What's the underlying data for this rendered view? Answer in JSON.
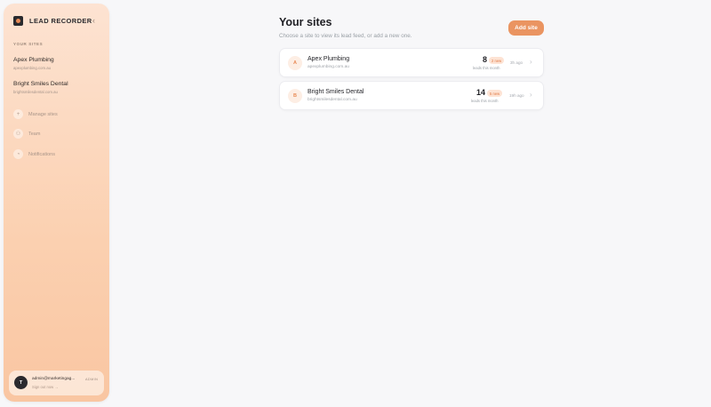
{
  "sidebar": {
    "brand": "LEAD RECORDER",
    "collapse_icon": "‹",
    "section_label": "YOUR SITES",
    "sites": [
      {
        "name": "Apex Plumbing",
        "domain": "apexplumbing.com.au"
      },
      {
        "name": "Bright Smiles Dental",
        "domain": "brightsmilesdental.com.au"
      }
    ],
    "nav": [
      {
        "label": "Manage sites",
        "icon": "+"
      },
      {
        "label": "Team",
        "icon": "⚇"
      },
      {
        "label": "Notifications",
        "icon": "◔"
      }
    ],
    "user": {
      "initial": "T",
      "email": "admin@marketingag...",
      "role": "ADMIN",
      "signout": "Sign out now →"
    }
  },
  "main": {
    "title": "Your sites",
    "subtitle": "Choose a site to view its lead feed, or add a new one.",
    "add_button": "Add site",
    "cards": [
      {
        "initial": "A",
        "name": "Apex Plumbing",
        "domain": "apexplumbing.com.au",
        "count": "8",
        "badge": "2 new",
        "leads_label": "leads this month",
        "ago": "3h ago"
      },
      {
        "initial": "B",
        "name": "Bright Smiles Dental",
        "domain": "brightsmilesdental.com.au",
        "count": "14",
        "badge": "5 new",
        "leads_label": "leads this month",
        "ago": "19h ago"
      }
    ]
  },
  "colors": {
    "accent": "#ea9461",
    "sidebar_top": "#fde3d2",
    "sidebar_bottom": "#f9c6a2",
    "background": "#f7f7f9"
  }
}
